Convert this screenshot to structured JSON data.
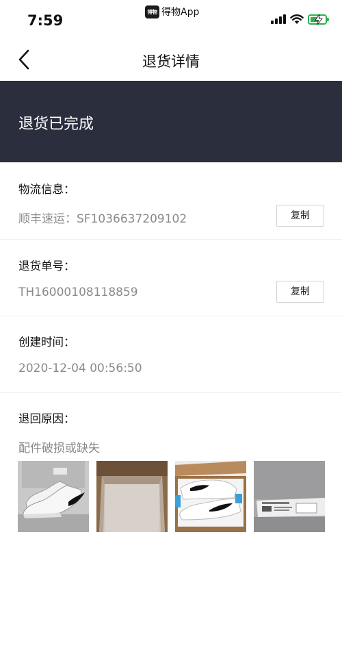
{
  "status_bar": {
    "time": "7:59",
    "app_logo_text": "得物",
    "app_name": "得物App",
    "icons": [
      "signal-icon",
      "wifi-icon",
      "battery-charging-icon"
    ],
    "battery_color": "#2bb24c"
  },
  "nav": {
    "back_icon": "chevron-left-icon",
    "title": "退货详情"
  },
  "banner": {
    "text": "退货已完成",
    "background": "#2b2e3d"
  },
  "logistics": {
    "label": "物流信息：",
    "value": "顺丰速运：SF1036637209102",
    "copy_label": "复制"
  },
  "return_number": {
    "label": "退货单号：",
    "value": "TH16000108118859",
    "copy_label": "复制"
  },
  "created_time": {
    "label": "创建时间：",
    "value": "2020-12-04 00:56:50"
  },
  "return_reason": {
    "label": "退回原因：",
    "value": "配件破损或缺失",
    "photos": [
      {
        "name": "photo-sneaker-box"
      },
      {
        "name": "photo-empty-box"
      },
      {
        "name": "photo-sneakers-in-box"
      },
      {
        "name": "photo-box-label"
      }
    ]
  }
}
